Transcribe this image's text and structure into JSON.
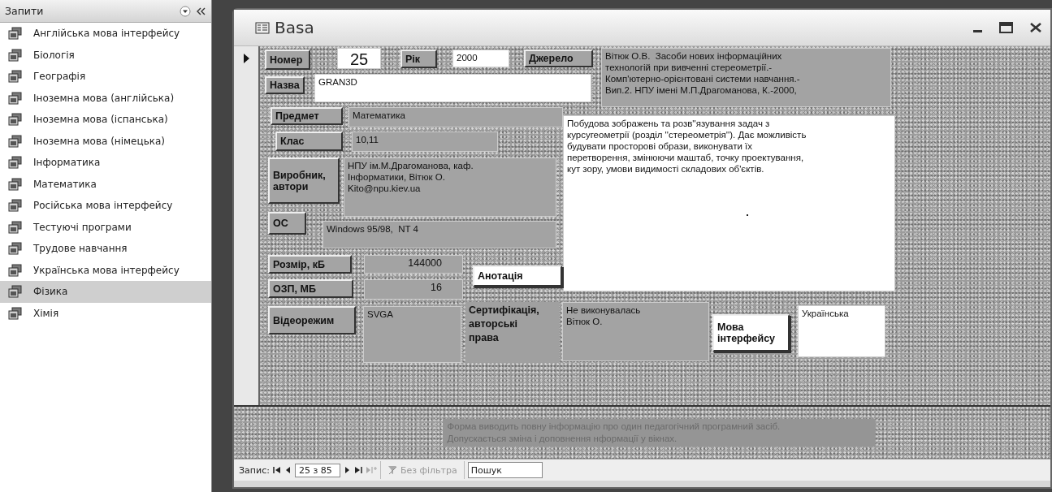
{
  "navigation_pane": {
    "title": "Запити",
    "items": [
      {
        "label": "Англійська мова інтерфейсу",
        "selected": false
      },
      {
        "label": "Біологія",
        "selected": false
      },
      {
        "label": "Географія",
        "selected": false
      },
      {
        "label": "Іноземна мова (англійська)",
        "selected": false
      },
      {
        "label": "Іноземна мова (іспанська)",
        "selected": false
      },
      {
        "label": "Іноземна мова (німецька)",
        "selected": false
      },
      {
        "label": "Інформатика",
        "selected": false
      },
      {
        "label": "Математика",
        "selected": false
      },
      {
        "label": "Російська мова інтерфейсу",
        "selected": false
      },
      {
        "label": "Тестуючі програми",
        "selected": false
      },
      {
        "label": "Трудове навчання",
        "selected": false
      },
      {
        "label": "Українська мова інтерфейсу",
        "selected": false
      },
      {
        "label": "Фізика",
        "selected": true
      },
      {
        "label": "Хімія",
        "selected": false
      }
    ]
  },
  "window": {
    "title": "Basa"
  },
  "form": {
    "controls": [
      {
        "kind": "label",
        "text": "Номер"
      },
      {
        "kind": "input",
        "text": "25"
      },
      {
        "kind": "label",
        "text": "Рік"
      },
      {
        "kind": "input",
        "text": "2000"
      },
      {
        "kind": "label",
        "text": "Джерело"
      },
      {
        "kind": "readout",
        "text": "Вітюк О.В.  Засоби нових інформаційних\nтехнологій при вивченні стереометрії.-\nКомп'ютерно-орієнтовані системи навчання.-\nВип.2. НПУ імені М.П.Драгоманова, К.-2000,"
      },
      {
        "kind": "label",
        "text": "Назва"
      },
      {
        "kind": "input",
        "text": "GRAN3D"
      },
      {
        "kind": "label",
        "text": "Предмет"
      },
      {
        "kind": "readout",
        "text": "Математика"
      },
      {
        "kind": "input",
        "text": "Побудова зображень та розв''язування задач з\nкурсугеометрії (розділ ''стереометрія''). Дає можливість\nбудувати просторові образи, виконувати їх\nперетворення, змінюючи маштаб, точку проектування,\nкут зору, умови видимості складових об'єктів."
      },
      {
        "kind": "label",
        "text": "Клас"
      },
      {
        "kind": "readout",
        "text": "10,11"
      },
      {
        "kind": "label",
        "text": "Виробник,\nавтори"
      },
      {
        "kind": "readout",
        "text": "НПУ ім.М.Драгоманова, каф.\nІнформатики, Вітюк О.\nKito@npu.kiev.ua"
      },
      {
        "kind": "label",
        "text": "ОС"
      },
      {
        "kind": "readout",
        "text": "Windows 95/98,  NT 4"
      },
      {
        "kind": "label",
        "text": "Розмір, кБ"
      },
      {
        "kind": "number",
        "text": "144000"
      },
      {
        "kind": "caption",
        "text": "Анотація"
      },
      {
        "kind": "label",
        "text": "ОЗП, МБ"
      },
      {
        "kind": "number",
        "text": "16"
      },
      {
        "kind": "label",
        "text": "Відеорежим"
      },
      {
        "kind": "readout",
        "text": "SVGA"
      },
      {
        "kind": "plain",
        "text": "Сертифікація,\nавторські\nправа"
      },
      {
        "kind": "readout",
        "text": "Не виконувалась\nВітюк О."
      },
      {
        "kind": "caption",
        "text": "Мова\nінтерфейсу"
      },
      {
        "kind": "input",
        "text": "Українська"
      }
    ],
    "footer_note": "Форма виводить повну інформацію про один педагогічний програмний засіб.\nДопускається зміна і доповнення нформації у вікнах."
  },
  "record_navigation": {
    "label": "Запис:",
    "position": "25 з 85",
    "filter": "Без фільтра",
    "search_placeholder": "Пошук"
  }
}
